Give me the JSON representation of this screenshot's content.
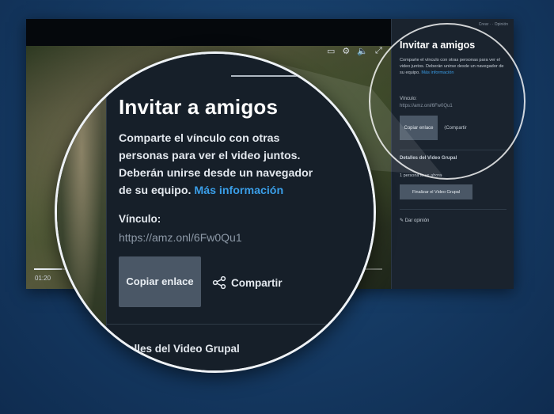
{
  "player": {
    "time": "01:20",
    "progress": 0.08,
    "side_top": "Crear ·  · Opinión"
  },
  "panel": {
    "title": "Invitar a amigos",
    "description": "Comparte el vínculo con otras personas para ver el video juntos. Deberán unirse desde un navegador de su equipo.",
    "more_link": "Más información",
    "link_label": "Vínculo:",
    "link_url": "https://amz.onl/6Fw0Qu1",
    "copy_button": "Copiar enlace",
    "share_button": "Compartir",
    "details_title": "Detalles del Video Grupal",
    "details_title_visible": "etalles del Video Grupal",
    "viewers": "1 persona lo ve ahora",
    "end_button": "Finalizar el Video Grupal",
    "opinion": "Dar opinión"
  },
  "colors": {
    "accent_link": "#3a9ee8",
    "panel_bg": "#161f29",
    "button_bg": "#4a5766"
  }
}
